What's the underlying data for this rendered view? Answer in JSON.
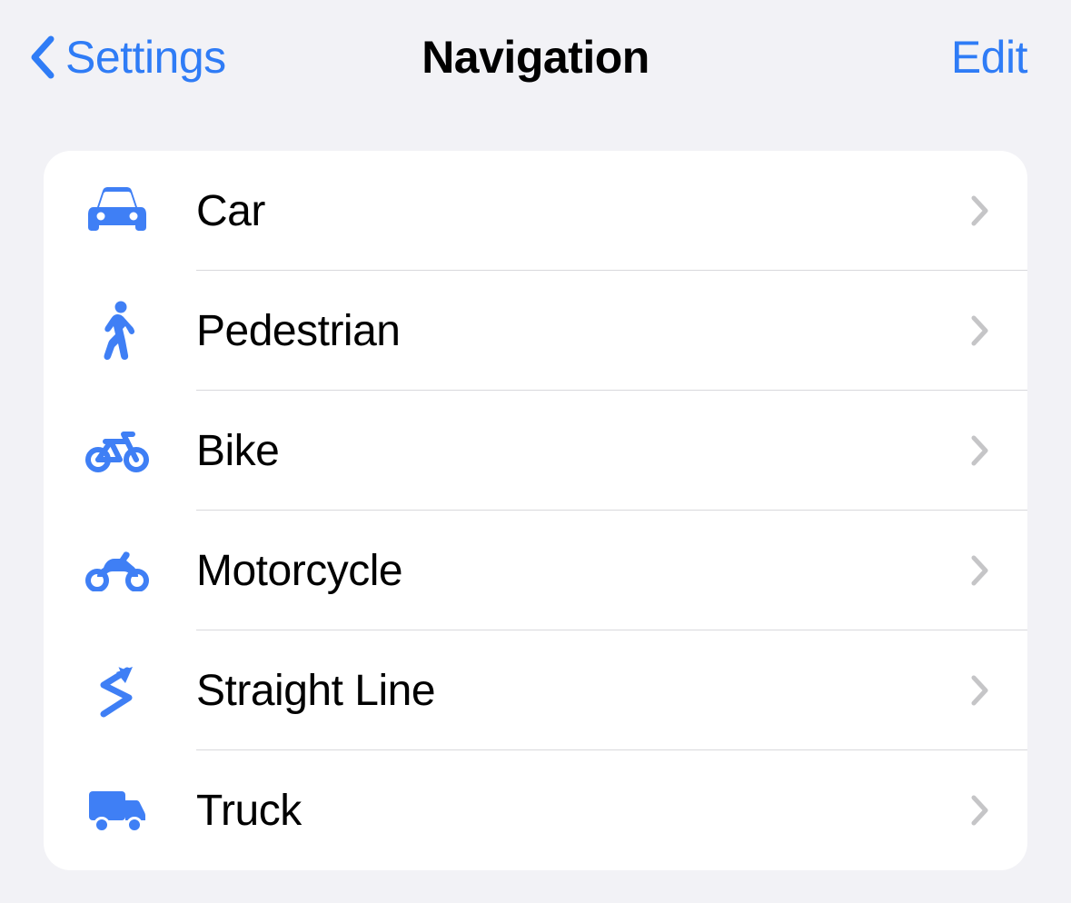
{
  "header": {
    "back_label": "Settings",
    "title": "Navigation",
    "edit_label": "Edit"
  },
  "list": {
    "items": [
      {
        "icon": "car-icon",
        "label": "Car"
      },
      {
        "icon": "pedestrian-icon",
        "label": "Pedestrian"
      },
      {
        "icon": "bike-icon",
        "label": "Bike"
      },
      {
        "icon": "motorcycle-icon",
        "label": "Motorcycle"
      },
      {
        "icon": "straight-line-icon",
        "label": "Straight Line"
      },
      {
        "icon": "truck-icon",
        "label": "Truck"
      }
    ]
  },
  "colors": {
    "accent": "#2f7cf6",
    "icon": "#3f7ff5",
    "chevron": "#c5c5c7",
    "divider": "#d8d8dc"
  }
}
